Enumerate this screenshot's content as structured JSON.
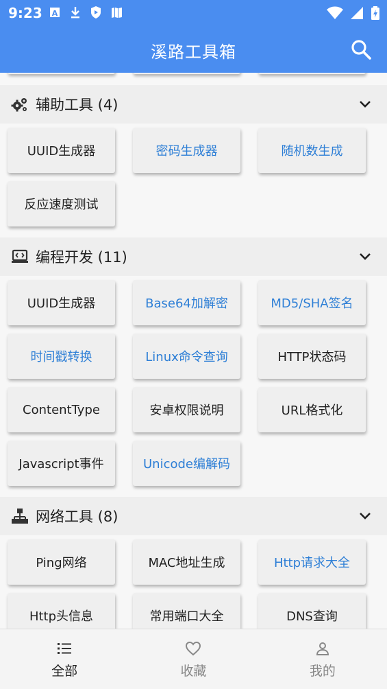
{
  "status_bar": {
    "time": "9:23"
  },
  "app_bar": {
    "title": "溪路工具箱"
  },
  "sections": [
    {
      "title": "",
      "items": [
        {
          "label": "",
          "style": "normal"
        },
        {
          "label": "",
          "style": "normal"
        },
        {
          "label": "",
          "style": "normal"
        }
      ]
    },
    {
      "title": "辅助工具 (4)",
      "icon": "gears-icon",
      "items": [
        {
          "label": "UUID生成器",
          "style": "normal"
        },
        {
          "label": "密码生成器",
          "style": "link"
        },
        {
          "label": "随机数生成",
          "style": "link"
        },
        {
          "label": "反应速度测试",
          "style": "normal"
        }
      ]
    },
    {
      "title": "编程开发 (11)",
      "icon": "laptop-code-icon",
      "items": [
        {
          "label": "UUID生成器",
          "style": "normal"
        },
        {
          "label": "Base64加解密",
          "style": "link"
        },
        {
          "label": "MD5/SHA签名",
          "style": "link"
        },
        {
          "label": "时间戳转换",
          "style": "link"
        },
        {
          "label": "Linux命令查询",
          "style": "link"
        },
        {
          "label": "HTTP状态码",
          "style": "normal"
        },
        {
          "label": "ContentType",
          "style": "normal"
        },
        {
          "label": "安卓权限说明",
          "style": "normal"
        },
        {
          "label": "URL格式化",
          "style": "normal"
        },
        {
          "label": "Javascript事件",
          "style": "normal"
        },
        {
          "label": "Unicode编解码",
          "style": "link"
        }
      ]
    },
    {
      "title": "网络工具 (8)",
      "icon": "network-icon",
      "items": [
        {
          "label": "Ping网络",
          "style": "normal"
        },
        {
          "label": "MAC地址生成",
          "style": "normal"
        },
        {
          "label": "Http请求大全",
          "style": "link"
        },
        {
          "label": "Http头信息",
          "style": "normal"
        },
        {
          "label": "常用端口大全",
          "style": "normal"
        },
        {
          "label": "DNS查询",
          "style": "normal"
        }
      ]
    }
  ],
  "bottom_nav": [
    {
      "label": "全部",
      "icon": "list-icon",
      "active": true
    },
    {
      "label": "收藏",
      "icon": "heart-icon",
      "active": false
    },
    {
      "label": "我的",
      "icon": "person-icon",
      "active": false
    }
  ],
  "colors": {
    "primary": "#4a8df0",
    "link_text": "#2e7fd6"
  }
}
